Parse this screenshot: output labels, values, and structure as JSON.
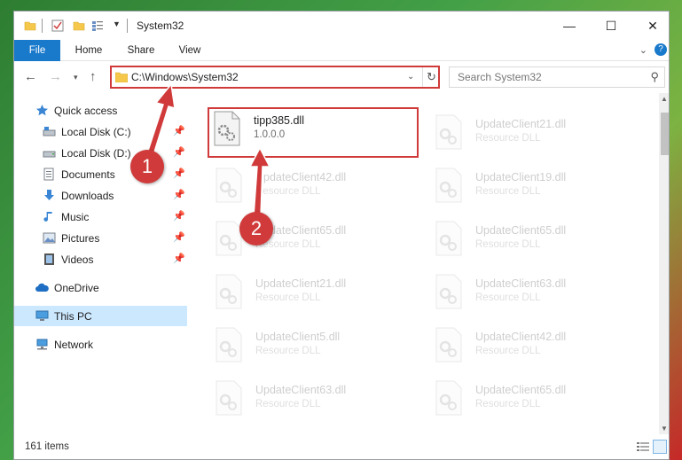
{
  "titlebar": {
    "title": "System32",
    "minimize_glyph": "—",
    "maximize_glyph": "☐",
    "close_glyph": "✕"
  },
  "ribbon": {
    "tabs": [
      "File",
      "Home",
      "Share",
      "View"
    ]
  },
  "nav": {
    "address": "C:\\Windows\\System32",
    "search_placeholder": "Search System32"
  },
  "sidebar": {
    "items": [
      {
        "label": "Quick access",
        "icon": "star-icon"
      },
      {
        "label": "Local Disk (C:)",
        "icon": "drive-icon"
      },
      {
        "label": "Local Disk (D:)",
        "icon": "drive-icon"
      },
      {
        "label": "Documents",
        "icon": "documents-icon"
      },
      {
        "label": "Downloads",
        "icon": "download-icon"
      },
      {
        "label": "Music",
        "icon": "music-icon"
      },
      {
        "label": "Pictures",
        "icon": "pictures-icon"
      },
      {
        "label": "Videos",
        "icon": "videos-icon"
      },
      {
        "label": "OneDrive",
        "icon": "cloud-icon"
      },
      {
        "label": "This PC",
        "icon": "computer-icon"
      },
      {
        "label": "Network",
        "icon": "network-icon"
      }
    ]
  },
  "files": {
    "left": [
      {
        "name": "tipp385.dll",
        "desc": "1.0.0.0"
      },
      {
        "name": "UpdateClient42.dll",
        "desc": "Resource DLL"
      },
      {
        "name": "UpdateClient65.dll",
        "desc": "Resource DLL"
      },
      {
        "name": "UpdateClient21.dll",
        "desc": "Resource DLL"
      },
      {
        "name": "UpdateClient5.dll",
        "desc": "Resource DLL"
      },
      {
        "name": "UpdateClient63.dll",
        "desc": "Resource DLL"
      }
    ],
    "right": [
      {
        "name": "UpdateClient21.dll",
        "desc": "Resource DLL"
      },
      {
        "name": "UpdateClient19.dll",
        "desc": "Resource DLL"
      },
      {
        "name": "UpdateClient65.dll",
        "desc": "Resource DLL"
      },
      {
        "name": "UpdateClient63.dll",
        "desc": "Resource DLL"
      },
      {
        "name": "UpdateClient42.dll",
        "desc": "Resource DLL"
      },
      {
        "name": "UpdateClient65.dll",
        "desc": "Resource DLL"
      }
    ]
  },
  "status": {
    "count": "161 items"
  },
  "annotations": {
    "step1": "1",
    "step2": "2",
    "color": "#d03a3a"
  }
}
